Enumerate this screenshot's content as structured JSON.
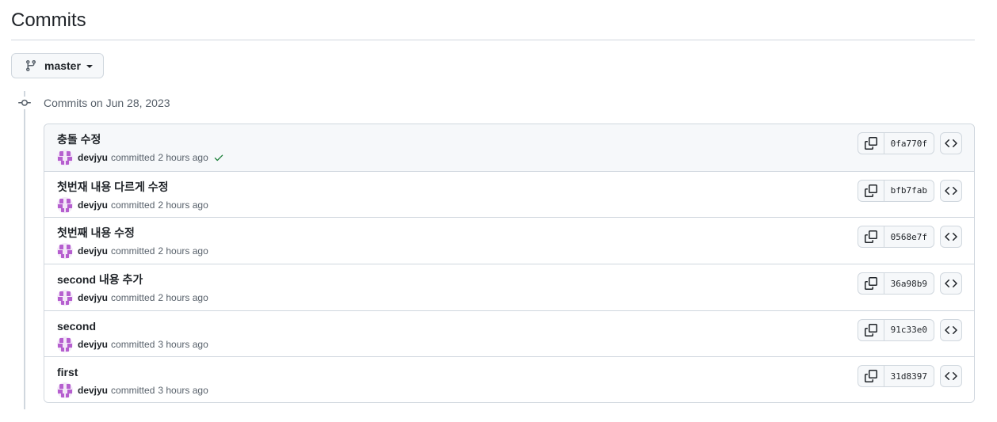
{
  "page": {
    "title": "Commits"
  },
  "branch": {
    "label": "master",
    "icon": "git-branch-icon"
  },
  "timeline": {
    "group_label": "Commits on Jun 28, 2023",
    "icon": "git-commit-icon"
  },
  "commits": [
    {
      "title": "충돌 수정",
      "author": "devjyu",
      "action": "committed",
      "time": "2 hours ago",
      "sha": "0fa770f",
      "verified": true
    },
    {
      "title": "첫번재 내용 다르게 수정",
      "author": "devjyu",
      "action": "committed",
      "time": "2 hours ago",
      "sha": "bfb7fab",
      "verified": false
    },
    {
      "title": "첫번째 내용 수정",
      "author": "devjyu",
      "action": "committed",
      "time": "2 hours ago",
      "sha": "0568e7f",
      "verified": false
    },
    {
      "title": "second 내용 추가",
      "author": "devjyu",
      "action": "committed",
      "time": "2 hours ago",
      "sha": "36a98b9",
      "verified": false
    },
    {
      "title": "second",
      "author": "devjyu",
      "action": "committed",
      "time": "3 hours ago",
      "sha": "91c33e0",
      "verified": false
    },
    {
      "title": "first",
      "author": "devjyu",
      "action": "committed",
      "time": "3 hours ago",
      "sha": "31d8397",
      "verified": false
    }
  ],
  "colors": {
    "border": "#d0d7de",
    "muted_text": "#57606a",
    "success": "#1a7f37",
    "avatar": "#b65fcf"
  }
}
